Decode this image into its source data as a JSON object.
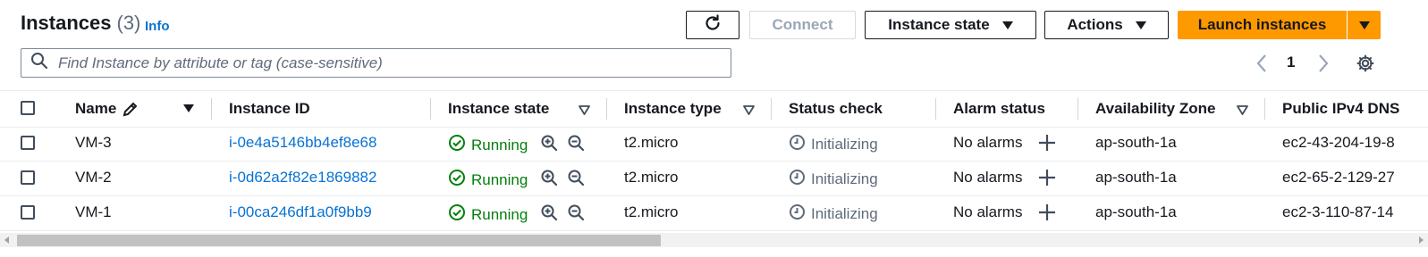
{
  "header": {
    "title": "Instances",
    "count": "(3)",
    "info_link": "Info"
  },
  "toolbar": {
    "connect_label": "Connect",
    "instance_state_label": "Instance state",
    "actions_label": "Actions",
    "launch_label": "Launch instances"
  },
  "search": {
    "placeholder": "Find Instance by attribute or tag (case-sensitive)"
  },
  "pagination": {
    "current_page": "1"
  },
  "table": {
    "columns": {
      "name": "Name",
      "instance_id": "Instance ID",
      "instance_state": "Instance state",
      "instance_type": "Instance type",
      "status_check": "Status check",
      "alarm_status": "Alarm status",
      "availability_zone": "Availability Zone",
      "public_dns": "Public IPv4 DNS"
    },
    "rows": [
      {
        "name": "VM-3",
        "instance_id": "i-0e4a5146bb4ef8e68",
        "state": "Running",
        "type": "t2.micro",
        "status": "Initializing",
        "alarm": "No alarms",
        "az": "ap-south-1a",
        "dns": "ec2-43-204-19-8"
      },
      {
        "name": "VM-2",
        "instance_id": "i-0d62a2f82e1869882",
        "state": "Running",
        "type": "t2.micro",
        "status": "Initializing",
        "alarm": "No alarms",
        "az": "ap-south-1a",
        "dns": "ec2-65-2-129-27"
      },
      {
        "name": "VM-1",
        "instance_id": "i-00ca246df1a0f9bb9",
        "state": "Running",
        "type": "t2.micro",
        "status": "Initializing",
        "alarm": "No alarms",
        "az": "ap-south-1a",
        "dns": "ec2-3-110-87-14"
      }
    ]
  },
  "colors": {
    "primary": "#ff9900",
    "link": "#0972d3",
    "running": "#037f0c",
    "muted": "#5f6b7a"
  },
  "icons": [
    "refresh-icon",
    "search-icon",
    "chevron-left-icon",
    "chevron-right-icon",
    "settings-gear-icon",
    "edit-pencil-icon",
    "zoom-in-icon",
    "zoom-out-icon",
    "check-circle-icon",
    "clock-icon",
    "plus-icon"
  ]
}
